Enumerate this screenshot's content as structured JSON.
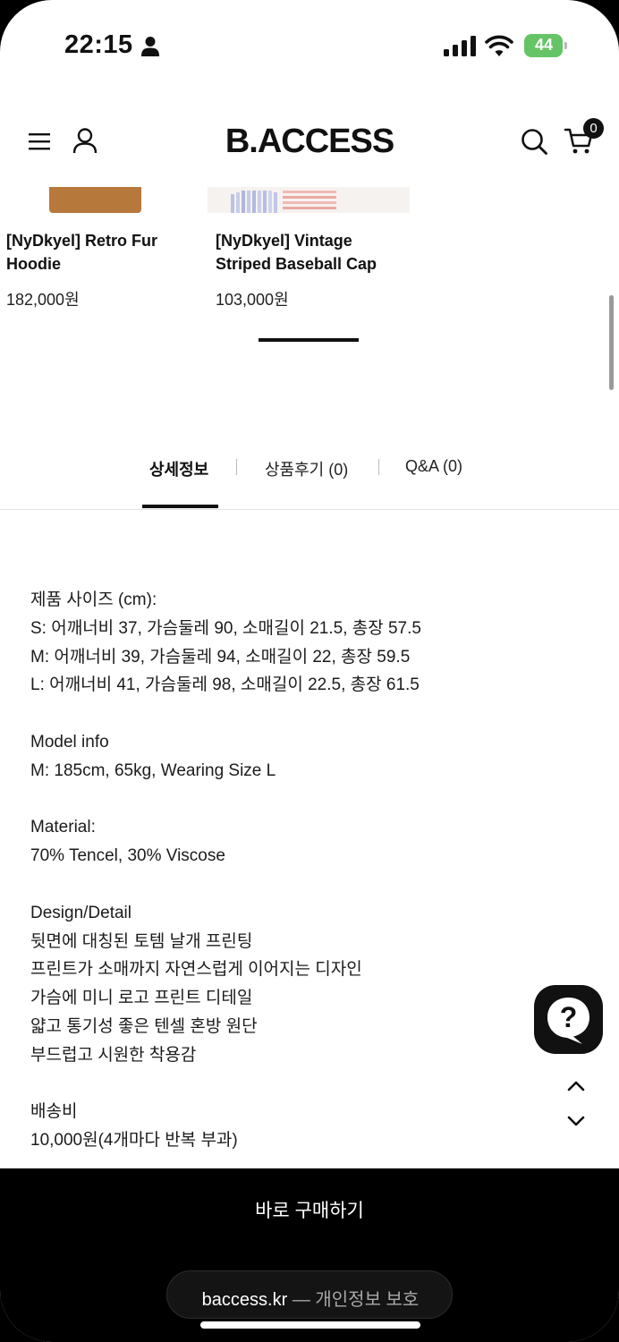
{
  "status_bar": {
    "time": "22:15",
    "battery": "44"
  },
  "header": {
    "logo": "B.ACCESS",
    "cart_count": "0"
  },
  "related_products": [
    {
      "title_line1": "[NyDkyel] Retro Fur",
      "title_line2": "Hoodie",
      "price": "182,000원"
    },
    {
      "title_line1": "[NyDkyel] Vintage",
      "title_line2": "Striped Baseball Cap",
      "price": "103,000원"
    }
  ],
  "tabs": {
    "detail": "상세정보",
    "reviews": "상품후기 (0)",
    "qa": "Q&A (0)"
  },
  "detail": {
    "size_title": "제품 사이즈 (cm):",
    "size_s": "S: 어깨너비 37, 가슴둘레 90, 소매길이 21.5, 총장 57.5",
    "size_m": "M: 어깨너비 39, 가슴둘레 94, 소매길이 22, 총장 59.5",
    "size_l": "L: 어깨너비 41, 가슴둘레 98, 소매길이 22.5, 총장 61.5",
    "model_title": "Model info",
    "model_value": "M: 185cm, 65kg, Wearing Size L",
    "material_title": "Material:",
    "material_value": "70% Tencel, 30% Viscose",
    "design_title": "Design/Detail",
    "design_lines": [
      "뒷면에 대칭된 토템 날개 프린팅",
      "프린트가 소매까지 자연스럽게 이어지는 디자인",
      "가슴에 미니 로고 프린트 디테일",
      "얇고 통기성 좋은 텐셀 혼방 원단",
      "부드럽고 시원한 착용감"
    ],
    "shipping_title": "배송비",
    "shipping_value": "10,000원(4개마다 반복 부과)"
  },
  "buy_button": "바로 구매하기",
  "browser": {
    "domain": "baccess.kr",
    "privacy": "— 개인정보 보호"
  },
  "colors": {
    "battery_green": "#65c466",
    "dark": "#111111"
  }
}
